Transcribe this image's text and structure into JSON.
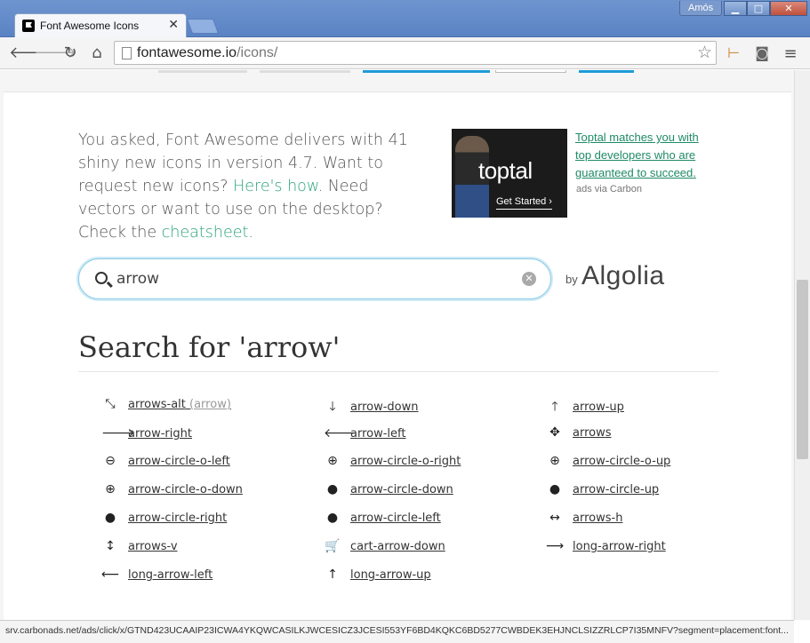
{
  "browser": {
    "tab_title": "Font Awesome Icons",
    "tab_close": "✕",
    "user_name": "Amós",
    "url_host": "fontawesome.io",
    "url_path": "/icons/",
    "status_url": "srv.carbonads.net/ads/click/x/GTND423UCAAIP23ICWA4YKQWCASILKJWCESICZ3JCESI553YF6BD4KQKC6BD5277CWBDEK3EHJNCLSIZZRLCP7I35MNFV?segment=placement:font..."
  },
  "intro": {
    "text_1": "You asked, Font Awesome delivers with 41 shiny new icons in version 4.7. Want to request new icons? ",
    "link_1": "Here's how",
    "text_2": ". Need vectors or want to use on the desktop? Check the ",
    "link_2": "cheatsheet",
    "text_3": "."
  },
  "ad": {
    "brand": "toptal",
    "cta": "Get Started ›",
    "text": "Toptal matches you with top developers who are guaranteed to succeed.",
    "via": "ads via Carbon"
  },
  "search": {
    "value": "arrow",
    "by": "by",
    "provider": "Algolia"
  },
  "results": {
    "title": "Search for 'arrow'",
    "items": [
      {
        "pre": "",
        "match": "arrow",
        "post": "s-alt",
        "alias_pre": " (",
        "alias_match": "arrow",
        "alias_post": ")",
        "icon": "arrows-alt-icon",
        "glyph": "⤡"
      },
      {
        "pre": "",
        "match": "arrow",
        "post": "-down",
        "icon": "arrow-down-icon",
        "glyph": "🡓"
      },
      {
        "pre": "",
        "match": "arrow",
        "post": "-up",
        "icon": "arrow-up-icon",
        "glyph": "🡑"
      },
      {
        "pre": "",
        "match": "arrow",
        "post": "-right",
        "icon": "arrow-right-icon",
        "glyph": "🡒"
      },
      {
        "pre": "",
        "match": "arrow",
        "post": "-left",
        "icon": "arrow-left-icon",
        "glyph": "🡐"
      },
      {
        "pre": "",
        "match": "arrow",
        "post": "s",
        "icon": "arrows-icon",
        "glyph": "✥"
      },
      {
        "pre": "",
        "match": "arrow",
        "post": "-circle-o-left",
        "icon": "arrow-circle-o-left-icon",
        "glyph": "⊖"
      },
      {
        "pre": "",
        "match": "arrow",
        "post": "-circle-o-right",
        "icon": "arrow-circle-o-right-icon",
        "glyph": "⊕"
      },
      {
        "pre": "",
        "match": "arrow",
        "post": "-circle-o-up",
        "icon": "arrow-circle-o-up-icon",
        "glyph": "⊕"
      },
      {
        "pre": "",
        "match": "arrow",
        "post": "-circle-o-down",
        "icon": "arrow-circle-o-down-icon",
        "glyph": "⊕"
      },
      {
        "pre": "",
        "match": "arrow",
        "post": "-circle-down",
        "icon": "arrow-circle-down-icon",
        "glyph": "●"
      },
      {
        "pre": "",
        "match": "arrow",
        "post": "-circle-up",
        "icon": "arrow-circle-up-icon",
        "glyph": "●"
      },
      {
        "pre": "",
        "match": "arrow",
        "post": "-circle-right",
        "icon": "arrow-circle-right-icon",
        "glyph": "●"
      },
      {
        "pre": "",
        "match": "arrow",
        "post": "-circle-left",
        "icon": "arrow-circle-left-icon",
        "glyph": "●"
      },
      {
        "pre": "",
        "match": "arrow",
        "post": "s-h",
        "icon": "arrows-h-icon",
        "glyph": "↔"
      },
      {
        "pre": "",
        "match": "arrow",
        "post": "s-v",
        "icon": "arrows-v-icon",
        "glyph": "↕"
      },
      {
        "pre": "cart-",
        "match": "arrow",
        "post": "-down",
        "icon": "cart-arrow-down-icon",
        "glyph": "🛒"
      },
      {
        "pre": "long-",
        "match": "arrow",
        "post": "-right",
        "icon": "long-arrow-right-icon",
        "glyph": "⟶"
      },
      {
        "pre": "long-",
        "match": "arrow",
        "post": "-left",
        "icon": "long-arrow-left-icon",
        "glyph": "⟵"
      },
      {
        "pre": "long-",
        "match": "arrow",
        "post": "-up",
        "icon": "long-arrow-up-icon",
        "glyph": "↑"
      }
    ]
  }
}
